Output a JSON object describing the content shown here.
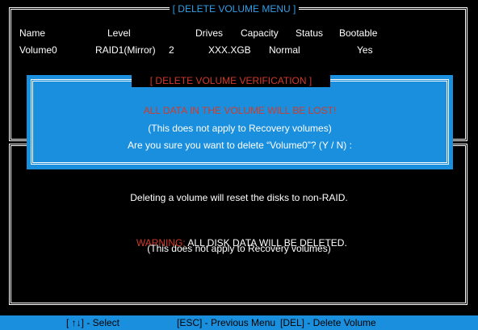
{
  "menu": {
    "title": "[ DELETE VOLUME MENU ]",
    "columns": [
      "Name",
      "Level",
      "Drives",
      "Capacity",
      "Status",
      "Bootable"
    ],
    "volume": {
      "name": "Volume0",
      "level": "RAID1(Mirror)",
      "drives": "2",
      "capacity": "XXX.XGB",
      "status": "Normal",
      "bootable": "Yes"
    }
  },
  "dialog": {
    "title": "[ DELETE VOLUME VERIFICATION ]",
    "line1": "ALL DATA IN THE VOLUME WILL BE LOST!",
    "line2": "(This does not apply to Recovery volumes)",
    "line3": "Are you sure you want to delete “Volume0”? (Y / N) :"
  },
  "info": {
    "line1": "Deleting a volume will reset the disks to non-RAID.",
    "warning_label": "WARNING:",
    "warning_text": " ALL DISK DATA WILL BE DELETED.",
    "line3": "(This does not apply to Recovery volumes)"
  },
  "footer": {
    "select": "[ ↑↓] - Select",
    "previous": "[ESC] - Previous Menu",
    "delete": "[DEL] - Delete Volume"
  },
  "colors": {
    "blue": "#1a8fde",
    "red": "#d23a2a",
    "title_cyan": "#2f9fe8",
    "background": "#000000"
  }
}
